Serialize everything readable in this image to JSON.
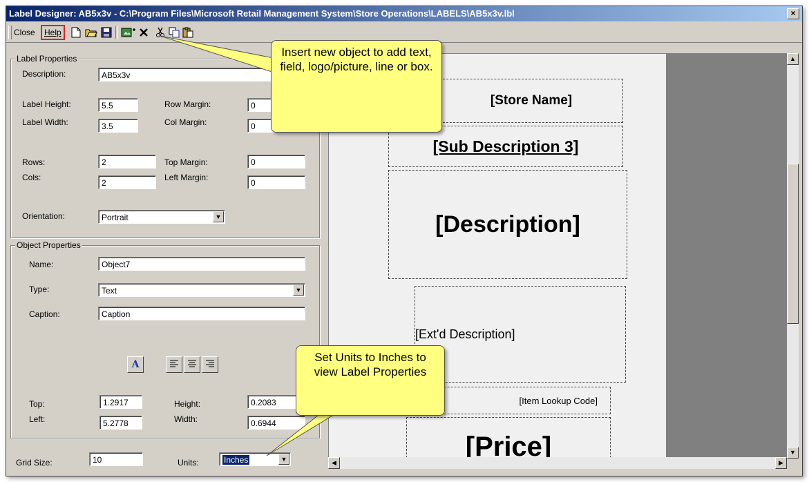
{
  "window": {
    "title": "Label Designer: AB5x3v - C:\\Program Files\\Microsoft Retail Management System\\Store Operations\\LABELS\\AB5x3v.lbl",
    "close_glyph": "×"
  },
  "toolbar": {
    "close_label": "Close",
    "help_label": "Help",
    "highlight_color": "#e02020",
    "icons": [
      "new-file-icon",
      "open-folder-icon",
      "save-icon",
      "insert-object-icon",
      "delete-icon",
      "cut-icon",
      "copy-icon",
      "paste-icon"
    ]
  },
  "label_properties": {
    "title": "Label Properties",
    "description_label": "Description:",
    "description_value": "AB5x3v",
    "label_height_label": "Label Height:",
    "label_height_value": "5.5",
    "label_width_label": "Label Width:",
    "label_width_value": "3.5",
    "rows_label": "Rows:",
    "rows_value": "2",
    "cols_label": "Cols:",
    "cols_value": "2",
    "row_margin_label": "Row Margin:",
    "row_margin_value": "0",
    "col_margin_label": "Col Margin:",
    "col_margin_value": "0",
    "top_margin_label": "Top Margin:",
    "top_margin_value": "0",
    "left_margin_label": "Left Margin:",
    "left_margin_value": "0",
    "orientation_label": "Orientation:",
    "orientation_value": "Portrait"
  },
  "object_properties": {
    "title": "Object Properties",
    "name_label": "Name:",
    "name_value": "Object7",
    "type_label": "Type:",
    "type_value": "Text",
    "caption_label": "Caption:",
    "caption_value": "Caption",
    "font_button": "A",
    "top_label": "Top:",
    "top_value": "1.2917",
    "left_label": "Left:",
    "left_value": "5.2778",
    "height_label": "Height:",
    "height_value": "0.2083",
    "width_label": "Width:",
    "width_value": "0.6944"
  },
  "footer": {
    "grid_size_label": "Grid Size:",
    "grid_size_value": "10",
    "units_label": "Units:",
    "units_value": "Inches"
  },
  "canvas_objects": {
    "store_name": "[Store Name]",
    "sub_description": "[Sub Description 3]",
    "description": "[Description]",
    "ext_description": "[Ext'd Description]",
    "item_lookup_code": "[Item Lookup Code]",
    "price": "[Price]"
  },
  "callouts": {
    "insert_object": "Insert new object to add text, field, logo/picture, line or box.",
    "set_units": "Set Units to Inches to view Label Properties"
  },
  "colors": {
    "callout_fill": "#ffff80",
    "title_bar_start": "#0a246a",
    "title_bar_end": "#a6caf0",
    "units_selected": "#0a246a"
  }
}
